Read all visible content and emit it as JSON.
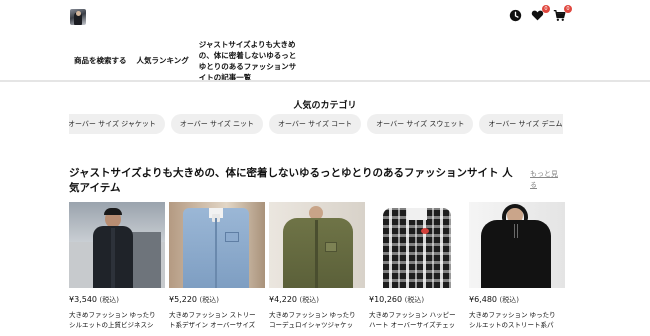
{
  "header": {
    "logo_icon": "person-photo-logo",
    "icons": [
      {
        "name": "history-icon",
        "badge": ""
      },
      {
        "name": "heart-icon",
        "badge": "0"
      },
      {
        "name": "cart-icon",
        "badge": "0"
      }
    ],
    "badge_color": "#e0483f"
  },
  "nav": {
    "search": "商品を検索する",
    "ranking": "人気ランキング",
    "articles": "ジャストサイズよりも大きめの、体に密着しないゆるっとゆとりのあるファッションサイトの記事一覧"
  },
  "categories": {
    "title": "人気のカテゴリ",
    "chips": [
      "オーバー サイズ ジャケット",
      "オーバー サイズ ニット",
      "オーバー サイズ コート",
      "オーバー サイズ スウェット",
      "オーバー サイズ デニム ジャケット"
    ]
  },
  "popular": {
    "title": "ジャストサイズよりも大きめの、体に密着しないゆるっとゆとりのあるファッションサイト 人気アイテム",
    "more": "もっと見る",
    "products": [
      {
        "price": "¥3,540",
        "tax": "(税込)",
        "desc": "大きめファッション ゆったりシルエットの上質ビジネスシャツ"
      },
      {
        "price": "¥5,220",
        "tax": "(税込)",
        "desc": "大きめファッション ストリート系デザイン オーバーサイズデニムシャツ"
      },
      {
        "price": "¥4,220",
        "tax": "(税込)",
        "desc": "大きめファッション ゆったりコーデュロイシャツジャケット"
      },
      {
        "price": "¥10,260",
        "tax": "(税込)",
        "desc": "大きめファッション ハッピーハート オーバーサイズチェックシャツ"
      },
      {
        "price": "¥6,480",
        "tax": "(税込)",
        "desc": "大きめファッション ゆったりシルエットのストリート系パーカー"
      }
    ]
  }
}
